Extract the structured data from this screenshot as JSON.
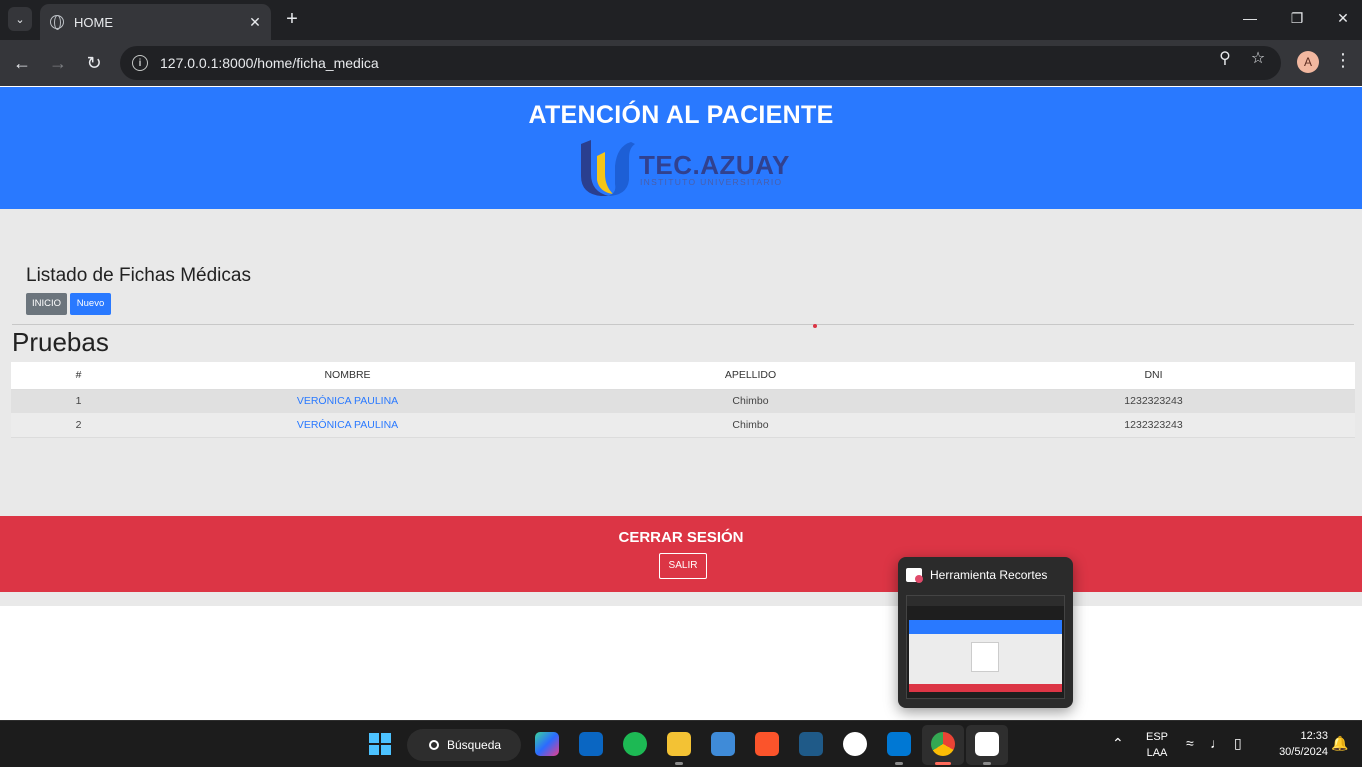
{
  "browser": {
    "tab_title": "HOME",
    "url": "127.0.0.1:8000/home/ficha_medica",
    "profile_initial": "A"
  },
  "header": {
    "title": "ATENCIÓN AL PACIENTE",
    "logo_text": "TEC.AZUAY",
    "logo_subtext": "INSTITUTO UNIVERSITARIO"
  },
  "main": {
    "list_title": "Listado de Fichas Médicas",
    "btn_inicio": "INICIO",
    "btn_nuevo": "Nuevo",
    "section_title": "Pruebas",
    "table": {
      "columns": [
        "#",
        "NOMBRE",
        "APELLIDO",
        "DNI"
      ],
      "rows": [
        {
          "num": "1",
          "nombre": "VERÓNICA PAULINA",
          "apellido": "Chimbo",
          "dni": "1232323243"
        },
        {
          "num": "2",
          "nombre": "VERÓNICA PAULINA",
          "apellido": "Chimbo",
          "dni": "1232323243"
        }
      ]
    }
  },
  "logout": {
    "title": "CERRAR SESIÓN",
    "button": "SALIR"
  },
  "snip_popup": {
    "title": "Herramienta Recortes"
  },
  "taskbar": {
    "search_label": "Búsqueda",
    "lang_top": "ESP",
    "lang_bottom": "LAA",
    "time": "12:33",
    "date": "30/5/2024"
  },
  "colors": {
    "primary": "#2979ff",
    "danger": "#dc3545",
    "secondary": "#6c757d"
  }
}
